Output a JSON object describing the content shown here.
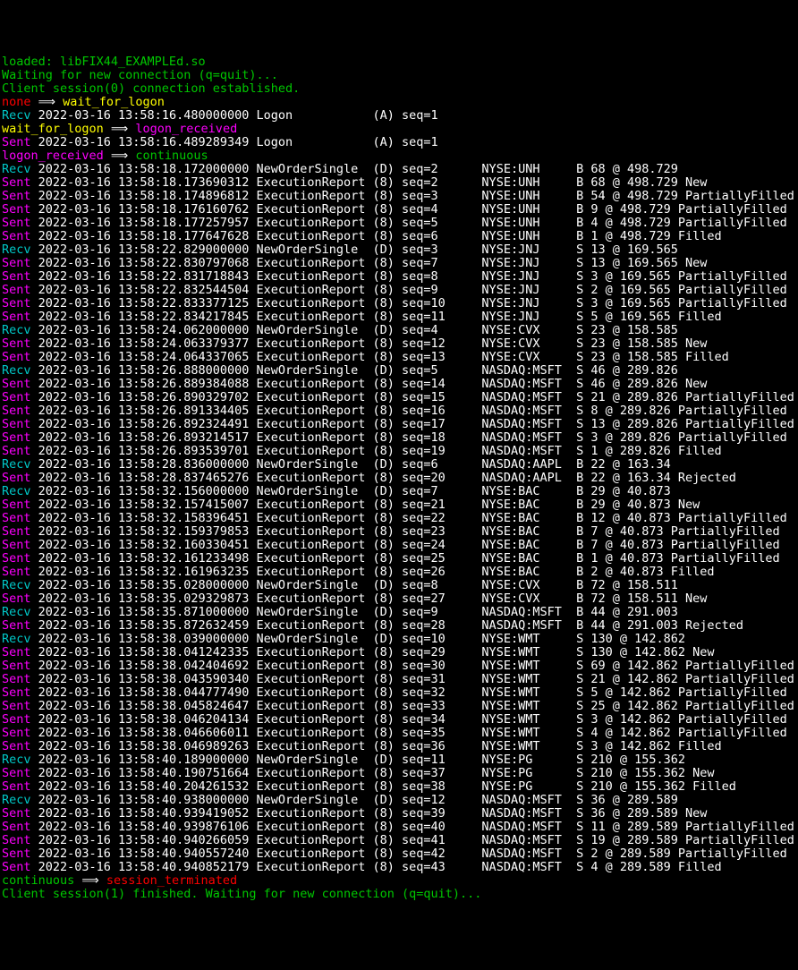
{
  "header": {
    "loaded": "loaded: libFIX44_EXAMPLEd.so",
    "waiting": "Waiting for new connection (q=quit)...",
    "session_est": "Client session(0) connection established."
  },
  "trans1": {
    "from": "none",
    "arrow": " ⟹ ",
    "to": "wait_for_logon"
  },
  "trans2": {
    "from": "wait_for_logon",
    "arrow": " ⟹ ",
    "to": "logon_received"
  },
  "trans3": {
    "from": "logon_received",
    "arrow": " ⟹ ",
    "to": "continuous"
  },
  "trans4": {
    "from": "continuous",
    "arrow": " ⟹ ",
    "to": "session_terminated"
  },
  "dir": {
    "recv": "Recv",
    "sent": "Sent"
  },
  "log_recv_ts": " 2022-03-16 13:58:16.480000000 Logon           (A) seq=1",
  "log_sent_ts": " 2022-03-16 13:58:16.489289349 Logon           (A) seq=1",
  "rows": [
    {
      "d": "Recv",
      "ts": " 2022-03-16 13:58:18.172000000 NewOrderSingle  (D) seq=2      NYSE:UNH     B 68 @ 498.729"
    },
    {
      "d": "Sent",
      "ts": " 2022-03-16 13:58:18.173690312 ExecutionReport (8) seq=2      NYSE:UNH     B 68 @ 498.729 New"
    },
    {
      "d": "Sent",
      "ts": " 2022-03-16 13:58:18.174896812 ExecutionReport (8) seq=3      NYSE:UNH     B 54 @ 498.729 PartiallyFilled"
    },
    {
      "d": "Sent",
      "ts": " 2022-03-16 13:58:18.176160762 ExecutionReport (8) seq=4      NYSE:UNH     B 9 @ 498.729 PartiallyFilled"
    },
    {
      "d": "Sent",
      "ts": " 2022-03-16 13:58:18.177257957 ExecutionReport (8) seq=5      NYSE:UNH     B 4 @ 498.729 PartiallyFilled"
    },
    {
      "d": "Sent",
      "ts": " 2022-03-16 13:58:18.177647628 ExecutionReport (8) seq=6      NYSE:UNH     B 1 @ 498.729 Filled"
    },
    {
      "d": "Recv",
      "ts": " 2022-03-16 13:58:22.829000000 NewOrderSingle  (D) seq=3      NYSE:JNJ     S 13 @ 169.565"
    },
    {
      "d": "Sent",
      "ts": " 2022-03-16 13:58:22.830797068 ExecutionReport (8) seq=7      NYSE:JNJ     S 13 @ 169.565 New"
    },
    {
      "d": "Sent",
      "ts": " 2022-03-16 13:58:22.831718843 ExecutionReport (8) seq=8      NYSE:JNJ     S 3 @ 169.565 PartiallyFilled"
    },
    {
      "d": "Sent",
      "ts": " 2022-03-16 13:58:22.832544504 ExecutionReport (8) seq=9      NYSE:JNJ     S 2 @ 169.565 PartiallyFilled"
    },
    {
      "d": "Sent",
      "ts": " 2022-03-16 13:58:22.833377125 ExecutionReport (8) seq=10     NYSE:JNJ     S 3 @ 169.565 PartiallyFilled"
    },
    {
      "d": "Sent",
      "ts": " 2022-03-16 13:58:22.834217845 ExecutionReport (8) seq=11     NYSE:JNJ     S 5 @ 169.565 Filled"
    },
    {
      "d": "Recv",
      "ts": " 2022-03-16 13:58:24.062000000 NewOrderSingle  (D) seq=4      NYSE:CVX     S 23 @ 158.585"
    },
    {
      "d": "Sent",
      "ts": " 2022-03-16 13:58:24.063379377 ExecutionReport (8) seq=12     NYSE:CVX     S 23 @ 158.585 New"
    },
    {
      "d": "Sent",
      "ts": " 2022-03-16 13:58:24.064337065 ExecutionReport (8) seq=13     NYSE:CVX     S 23 @ 158.585 Filled"
    },
    {
      "d": "Recv",
      "ts": " 2022-03-16 13:58:26.888000000 NewOrderSingle  (D) seq=5      NASDAQ:MSFT  S 46 @ 289.826"
    },
    {
      "d": "Sent",
      "ts": " 2022-03-16 13:58:26.889384088 ExecutionReport (8) seq=14     NASDAQ:MSFT  S 46 @ 289.826 New"
    },
    {
      "d": "Sent",
      "ts": " 2022-03-16 13:58:26.890329702 ExecutionReport (8) seq=15     NASDAQ:MSFT  S 21 @ 289.826 PartiallyFilled"
    },
    {
      "d": "Sent",
      "ts": " 2022-03-16 13:58:26.891334405 ExecutionReport (8) seq=16     NASDAQ:MSFT  S 8 @ 289.826 PartiallyFilled"
    },
    {
      "d": "Sent",
      "ts": " 2022-03-16 13:58:26.892324491 ExecutionReport (8) seq=17     NASDAQ:MSFT  S 13 @ 289.826 PartiallyFilled"
    },
    {
      "d": "Sent",
      "ts": " 2022-03-16 13:58:26.893214517 ExecutionReport (8) seq=18     NASDAQ:MSFT  S 3 @ 289.826 PartiallyFilled"
    },
    {
      "d": "Sent",
      "ts": " 2022-03-16 13:58:26.893539701 ExecutionReport (8) seq=19     NASDAQ:MSFT  S 1 @ 289.826 Filled"
    },
    {
      "d": "Recv",
      "ts": " 2022-03-16 13:58:28.836000000 NewOrderSingle  (D) seq=6      NASDAQ:AAPL  B 22 @ 163.34"
    },
    {
      "d": "Sent",
      "ts": " 2022-03-16 13:58:28.837465276 ExecutionReport (8) seq=20     NASDAQ:AAPL  B 22 @ 163.34 Rejected"
    },
    {
      "d": "Recv",
      "ts": " 2022-03-16 13:58:32.156000000 NewOrderSingle  (D) seq=7      NYSE:BAC     B 29 @ 40.873"
    },
    {
      "d": "Sent",
      "ts": " 2022-03-16 13:58:32.157415007 ExecutionReport (8) seq=21     NYSE:BAC     B 29 @ 40.873 New"
    },
    {
      "d": "Sent",
      "ts": " 2022-03-16 13:58:32.158396451 ExecutionReport (8) seq=22     NYSE:BAC     B 12 @ 40.873 PartiallyFilled"
    },
    {
      "d": "Sent",
      "ts": " 2022-03-16 13:58:32.159379853 ExecutionReport (8) seq=23     NYSE:BAC     B 7 @ 40.873 PartiallyFilled"
    },
    {
      "d": "Sent",
      "ts": " 2022-03-16 13:58:32.160330451 ExecutionReport (8) seq=24     NYSE:BAC     B 7 @ 40.873 PartiallyFilled"
    },
    {
      "d": "Sent",
      "ts": " 2022-03-16 13:58:32.161233498 ExecutionReport (8) seq=25     NYSE:BAC     B 1 @ 40.873 PartiallyFilled"
    },
    {
      "d": "Sent",
      "ts": " 2022-03-16 13:58:32.161963235 ExecutionReport (8) seq=26     NYSE:BAC     B 2 @ 40.873 Filled"
    },
    {
      "d": "Recv",
      "ts": " 2022-03-16 13:58:35.028000000 NewOrderSingle  (D) seq=8      NYSE:CVX     B 72 @ 158.511"
    },
    {
      "d": "Sent",
      "ts": " 2022-03-16 13:58:35.029329873 ExecutionReport (8) seq=27     NYSE:CVX     B 72 @ 158.511 New"
    },
    {
      "d": "Recv",
      "ts": " 2022-03-16 13:58:35.871000000 NewOrderSingle  (D) seq=9      NASDAQ:MSFT  B 44 @ 291.003"
    },
    {
      "d": "Sent",
      "ts": " 2022-03-16 13:58:35.872632459 ExecutionReport (8) seq=28     NASDAQ:MSFT  B 44 @ 291.003 Rejected"
    },
    {
      "d": "Recv",
      "ts": " 2022-03-16 13:58:38.039000000 NewOrderSingle  (D) seq=10     NYSE:WMT     S 130 @ 142.862"
    },
    {
      "d": "Sent",
      "ts": " 2022-03-16 13:58:38.041242335 ExecutionReport (8) seq=29     NYSE:WMT     S 130 @ 142.862 New"
    },
    {
      "d": "Sent",
      "ts": " 2022-03-16 13:58:38.042404692 ExecutionReport (8) seq=30     NYSE:WMT     S 69 @ 142.862 PartiallyFilled"
    },
    {
      "d": "Sent",
      "ts": " 2022-03-16 13:58:38.043590340 ExecutionReport (8) seq=31     NYSE:WMT     S 21 @ 142.862 PartiallyFilled"
    },
    {
      "d": "Sent",
      "ts": " 2022-03-16 13:58:38.044777490 ExecutionReport (8) seq=32     NYSE:WMT     S 5 @ 142.862 PartiallyFilled"
    },
    {
      "d": "Sent",
      "ts": " 2022-03-16 13:58:38.045824647 ExecutionReport (8) seq=33     NYSE:WMT     S 25 @ 142.862 PartiallyFilled"
    },
    {
      "d": "Sent",
      "ts": " 2022-03-16 13:58:38.046204134 ExecutionReport (8) seq=34     NYSE:WMT     S 3 @ 142.862 PartiallyFilled"
    },
    {
      "d": "Sent",
      "ts": " 2022-03-16 13:58:38.046606011 ExecutionReport (8) seq=35     NYSE:WMT     S 4 @ 142.862 PartiallyFilled"
    },
    {
      "d": "Sent",
      "ts": " 2022-03-16 13:58:38.046989263 ExecutionReport (8) seq=36     NYSE:WMT     S 3 @ 142.862 Filled"
    },
    {
      "d": "Recv",
      "ts": " 2022-03-16 13:58:40.189000000 NewOrderSingle  (D) seq=11     NYSE:PG      S 210 @ 155.362"
    },
    {
      "d": "Sent",
      "ts": " 2022-03-16 13:58:40.190751664 ExecutionReport (8) seq=37     NYSE:PG      S 210 @ 155.362 New"
    },
    {
      "d": "Sent",
      "ts": " 2022-03-16 13:58:40.204261532 ExecutionReport (8) seq=38     NYSE:PG      S 210 @ 155.362 Filled"
    },
    {
      "d": "Recv",
      "ts": " 2022-03-16 13:58:40.938000000 NewOrderSingle  (D) seq=12     NASDAQ:MSFT  S 36 @ 289.589"
    },
    {
      "d": "Sent",
      "ts": " 2022-03-16 13:58:40.939419052 ExecutionReport (8) seq=39     NASDAQ:MSFT  S 36 @ 289.589 New"
    },
    {
      "d": "Sent",
      "ts": " 2022-03-16 13:58:40.939876106 ExecutionReport (8) seq=40     NASDAQ:MSFT  S 11 @ 289.589 PartiallyFilled"
    },
    {
      "d": "Sent",
      "ts": " 2022-03-16 13:58:40.940266059 ExecutionReport (8) seq=41     NASDAQ:MSFT  S 19 @ 289.589 PartiallyFilled"
    },
    {
      "d": "Sent",
      "ts": " 2022-03-16 13:58:40.940557240 ExecutionReport (8) seq=42     NASDAQ:MSFT  S 2 @ 289.589 PartiallyFilled"
    },
    {
      "d": "Sent",
      "ts": " 2022-03-16 13:58:40.940852179 ExecutionReport (8) seq=43     NASDAQ:MSFT  S 4 @ 289.589 Filled"
    }
  ],
  "footer": {
    "finished": "Client session(1) finished. Waiting for new connection (q=quit)..."
  }
}
